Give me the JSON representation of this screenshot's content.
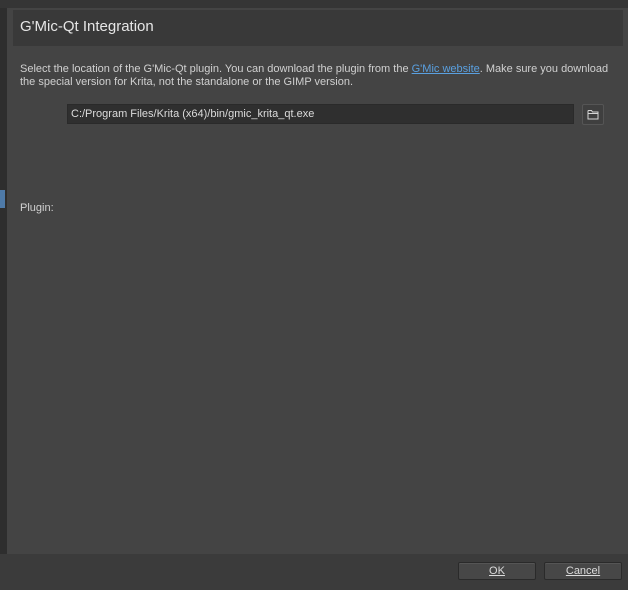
{
  "page": {
    "title": "G'Mic-Qt Integration",
    "description_before_link": "Select the location of the G'Mic-Qt plugin. You can download the plugin from the ",
    "link_text": "G'Mic website",
    "description_after_link": ". Make sure you download the special version for Krita, not the standalone or the GIMP version.",
    "plugin_path": "C:/Program Files/Krita (x64)/bin/gmic_krita_qt.exe",
    "browse_icon": "folder-icon",
    "plugin_label": "Plugin:"
  },
  "buttons": {
    "ok_label": "OK",
    "cancel_label": "Cancel"
  },
  "colors": {
    "link": "#5aa0e0",
    "accent": "#4e7aa8"
  }
}
